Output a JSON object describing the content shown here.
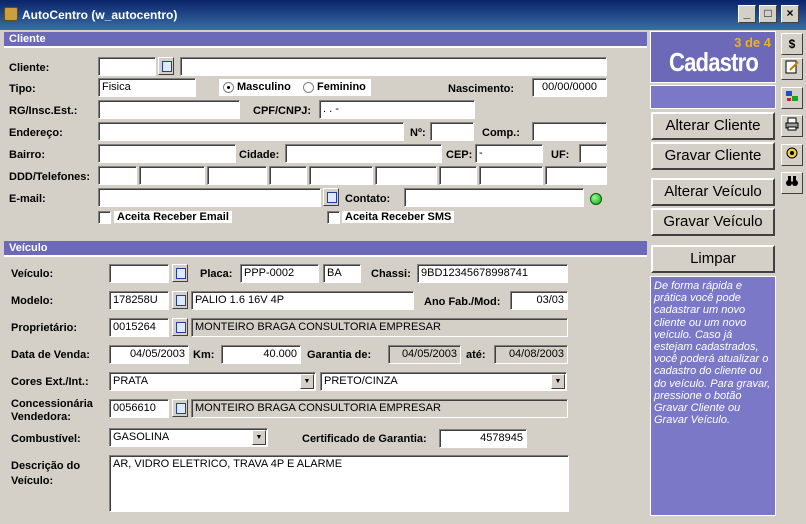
{
  "window": {
    "title": "AutoCentro (w_autocentro)"
  },
  "cliente": {
    "section": "Cliente",
    "lbl_cliente": "Cliente:",
    "lbl_tipo": "Tipo:",
    "tipo_value": "Fisica",
    "radio_masc": "Masculino",
    "radio_fem": "Feminino",
    "lbl_nasc": "Nascimento:",
    "nasc_value": "00/00/0000",
    "lbl_rg": "RG/Insc.Est.:",
    "lbl_cpf": "CPF/CNPJ:",
    "cpf_value": ". . -",
    "lbl_endereco": "Endereço:",
    "lbl_num": "Nº:",
    "lbl_comp": "Comp.:",
    "lbl_bairro": "Bairro:",
    "lbl_cidade": "Cidade:",
    "lbl_cep": "CEP:",
    "cep_value": "-",
    "lbl_uf": "UF:",
    "lbl_ddd": "DDD/Telefones:",
    "lbl_email": "E-mail:",
    "lbl_contato": "Contato:",
    "chk_email": "Aceita Receber Email",
    "chk_sms": "Aceita Receber SMS"
  },
  "veiculo": {
    "section": "Veículo",
    "lbl_veiculo": "Veículo:",
    "lbl_placa": "Placa:",
    "placa_value": "PPP-0002",
    "placa_uf": "BA",
    "lbl_chassi": "Chassi:",
    "chassi_value": "9BD12345678998741",
    "lbl_modelo": "Modelo:",
    "modelo_code": "178258U",
    "modelo_desc": "PALIO 1.6 16V 4P",
    "lbl_anofab": "Ano Fab./Mod:",
    "anofab_value": "03/03",
    "lbl_prop": "Proprietário:",
    "prop_code": "0015264",
    "prop_desc": "MONTEIRO BRAGA CONSULTORIA EMPRESAR",
    "lbl_venda": "Data de Venda:",
    "venda_value": "04/05/2003",
    "lbl_km": "Km:",
    "km_value": "40.000",
    "lbl_garantia": "Garantia de:",
    "garantia_de": "04/05/2003",
    "lbl_ate": "até:",
    "garantia_ate": "04/08/2003",
    "lbl_cores": "Cores Ext./Int.:",
    "cor_ext": "PRATA",
    "cor_int": "PRETO/CINZA",
    "lbl_conc1": "Concessionária",
    "lbl_conc2": "Vendedora:",
    "conc_code": "0056610",
    "conc_desc": "MONTEIRO BRAGA CONSULTORIA EMPRESAR",
    "lbl_comb": "Combustível:",
    "comb_value": "GASOLINA",
    "lbl_cert": "Certificado de Garantia:",
    "cert_value": "4578945",
    "lbl_desc1": "Descrição do",
    "lbl_desc2": "Veículo:",
    "desc_value": "AR, VIDRO ELETRICO, TRAVA 4P E ALARME"
  },
  "panel": {
    "step": "3 de 4",
    "title": "Cadastro",
    "btn_alt_cli": "Alterar Cliente",
    "btn_grv_cli": "Gravar Cliente",
    "btn_alt_vei": "Alterar Veículo",
    "btn_grv_vei": "Gravar Veículo",
    "btn_limpar": "Limpar",
    "help": "De forma rápida e prática você pode cadastrar um novo cliente ou um novo veículo. Caso já estejam cadastrados, você poderá atualizar o cadastro do cliente ou do veículo. Para gravar, pressione o botão Gravar Cliente ou Gravar Veículo."
  },
  "colors": {
    "section": "#6b69b8",
    "panel": "#7b78c8",
    "accent": "#f0b020"
  },
  "icons": [
    "dollar-icon",
    "edit-icon",
    "swap-icon",
    "printer-icon",
    "settings-icon",
    "binoculars-icon"
  ]
}
